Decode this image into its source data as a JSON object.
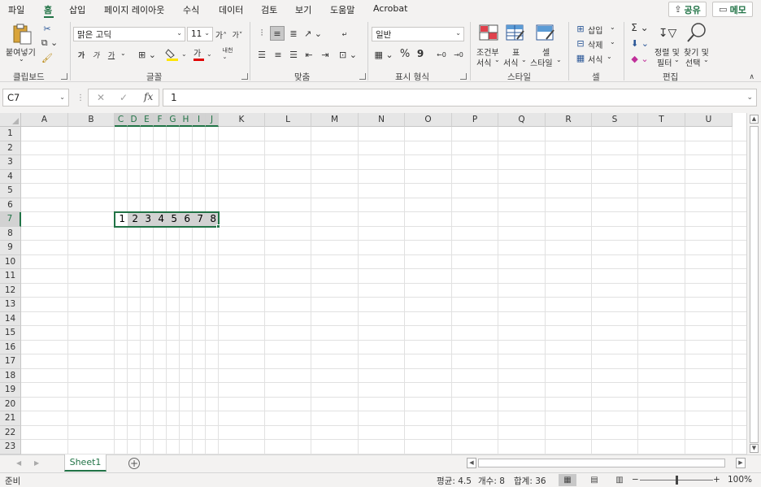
{
  "menu": {
    "tabs": [
      "파일",
      "홈",
      "삽입",
      "페이지 레이아웃",
      "수식",
      "데이터",
      "검토",
      "보기",
      "도움말",
      "Acrobat"
    ],
    "share_label": "공유",
    "memo_label": "메모"
  },
  "ribbon": {
    "clipboard": {
      "paste_label": "붙여넣기",
      "group_label": "클립보드"
    },
    "font": {
      "font_name": "맑은 고딕",
      "font_size": "11",
      "bold": "가",
      "italic": "가",
      "underline": "가",
      "group_label": "글꼴"
    },
    "alignment": {
      "group_label": "맞춤"
    },
    "number": {
      "format": "일반",
      "percent": "%",
      "comma": "9",
      "group_label": "표시 형식"
    },
    "styles": {
      "conditional_l1": "조건부",
      "conditional_l2": "서식",
      "table_l1": "표",
      "table_l2": "서식",
      "cell_l1": "셀",
      "cell_l2": "스타일",
      "group_label": "스타일"
    },
    "cells": {
      "insert": "삽입",
      "delete": "삭제",
      "format": "서식",
      "group_label": "셀"
    },
    "editing": {
      "sort_l1": "정렬 및",
      "sort_l2": "필터",
      "find_l1": "찾기 및",
      "find_l2": "선택",
      "group_label": "편집"
    }
  },
  "formula_bar": {
    "name_box": "C7",
    "fx": "fx",
    "value": "1"
  },
  "grid": {
    "columns": [
      "A",
      "B",
      "C",
      "D",
      "E",
      "F",
      "G",
      "H",
      "I",
      "J",
      "K",
      "L",
      "M",
      "N",
      "O",
      "P",
      "Q",
      "R",
      "S",
      "T",
      "U"
    ],
    "rows": [
      "1",
      "2",
      "3",
      "4",
      "5",
      "6",
      "7",
      "8",
      "9",
      "10",
      "11",
      "12",
      "13",
      "14",
      "15",
      "16",
      "17",
      "18",
      "19",
      "20",
      "21",
      "22",
      "23"
    ],
    "selected_row": "7",
    "selected_columns": [
      "C",
      "D",
      "E",
      "F",
      "G",
      "H",
      "I",
      "J"
    ],
    "row7_values": [
      "1",
      "2",
      "3",
      "4",
      "5",
      "6",
      "7",
      "8"
    ]
  },
  "sheets": {
    "tabs": [
      "Sheet1"
    ],
    "active": "Sheet1"
  },
  "status": {
    "ready": "준비",
    "average": "평균: 4.5",
    "count": "개수: 8",
    "sum": "합계: 36",
    "zoom": "100%"
  },
  "colors": {
    "accent": "#217346",
    "selection_fill": "#d2d2d2"
  }
}
